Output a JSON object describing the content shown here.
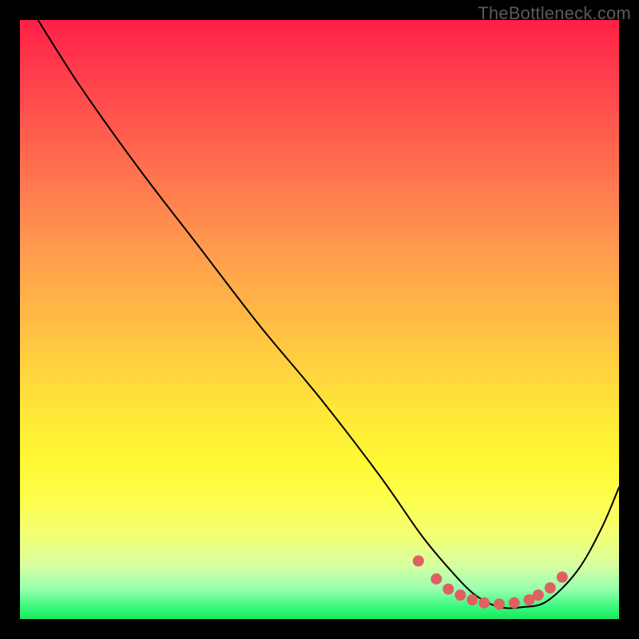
{
  "watermark": "TheBottleneck.com",
  "chart_data": {
    "type": "line",
    "title": "",
    "xlabel": "",
    "ylabel": "",
    "xlim": [
      0,
      1
    ],
    "ylim": [
      0,
      1
    ],
    "series": [
      {
        "name": "bottleneck-curve",
        "x": [
          0.03,
          0.1,
          0.2,
          0.3,
          0.4,
          0.5,
          0.6,
          0.67,
          0.72,
          0.76,
          0.8,
          0.84,
          0.88,
          0.93,
          0.97,
          1.0
        ],
        "y": [
          1.0,
          0.89,
          0.75,
          0.62,
          0.49,
          0.37,
          0.24,
          0.14,
          0.08,
          0.04,
          0.02,
          0.02,
          0.03,
          0.08,
          0.15,
          0.22
        ]
      }
    ],
    "markers": {
      "name": "valley-highlight",
      "color": "#e06062",
      "x": [
        0.665,
        0.695,
        0.715,
        0.735,
        0.755,
        0.775,
        0.8,
        0.825,
        0.85,
        0.865,
        0.885,
        0.905
      ],
      "y": [
        0.097,
        0.067,
        0.05,
        0.04,
        0.032,
        0.027,
        0.025,
        0.027,
        0.032,
        0.04,
        0.052,
        0.07
      ]
    },
    "background_gradient": {
      "top": "#ff1f47",
      "mid": "#ffe937",
      "bottom": "#18e85f"
    }
  }
}
